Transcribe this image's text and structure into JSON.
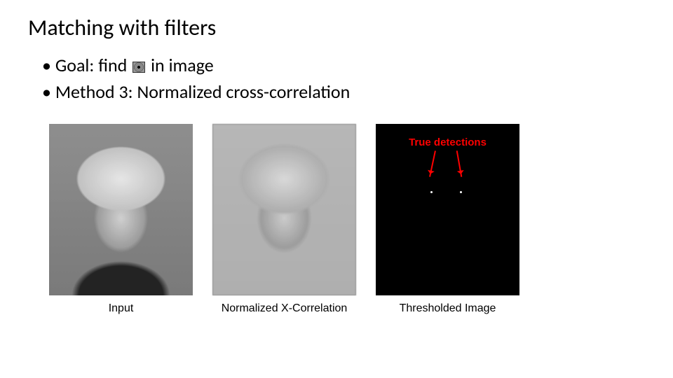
{
  "title": "Matching with filters",
  "bullets": {
    "goal_prefix": "Goal: find",
    "goal_suffix": "in image",
    "method": "Method 3: Normalized cross-correlation"
  },
  "threshold_label": "True detections",
  "captions": {
    "input": "Input",
    "xcorr": "Normalized X-Correlation",
    "thresh": "Thresholded Image"
  }
}
